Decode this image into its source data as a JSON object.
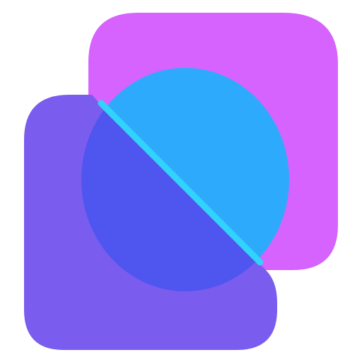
{
  "logo": {
    "colors": {
      "background": "#ffffff",
      "magenta": "#d663fd",
      "purple": "#7a5cef",
      "cyan": "#2eaafc",
      "indigo": "#4f55ef",
      "highlight": "#33d2fb"
    },
    "shapes": [
      "magenta-rounded-shape",
      "purple-rounded-shape",
      "cyan-ellipse",
      "diagonal-highlight"
    ]
  }
}
